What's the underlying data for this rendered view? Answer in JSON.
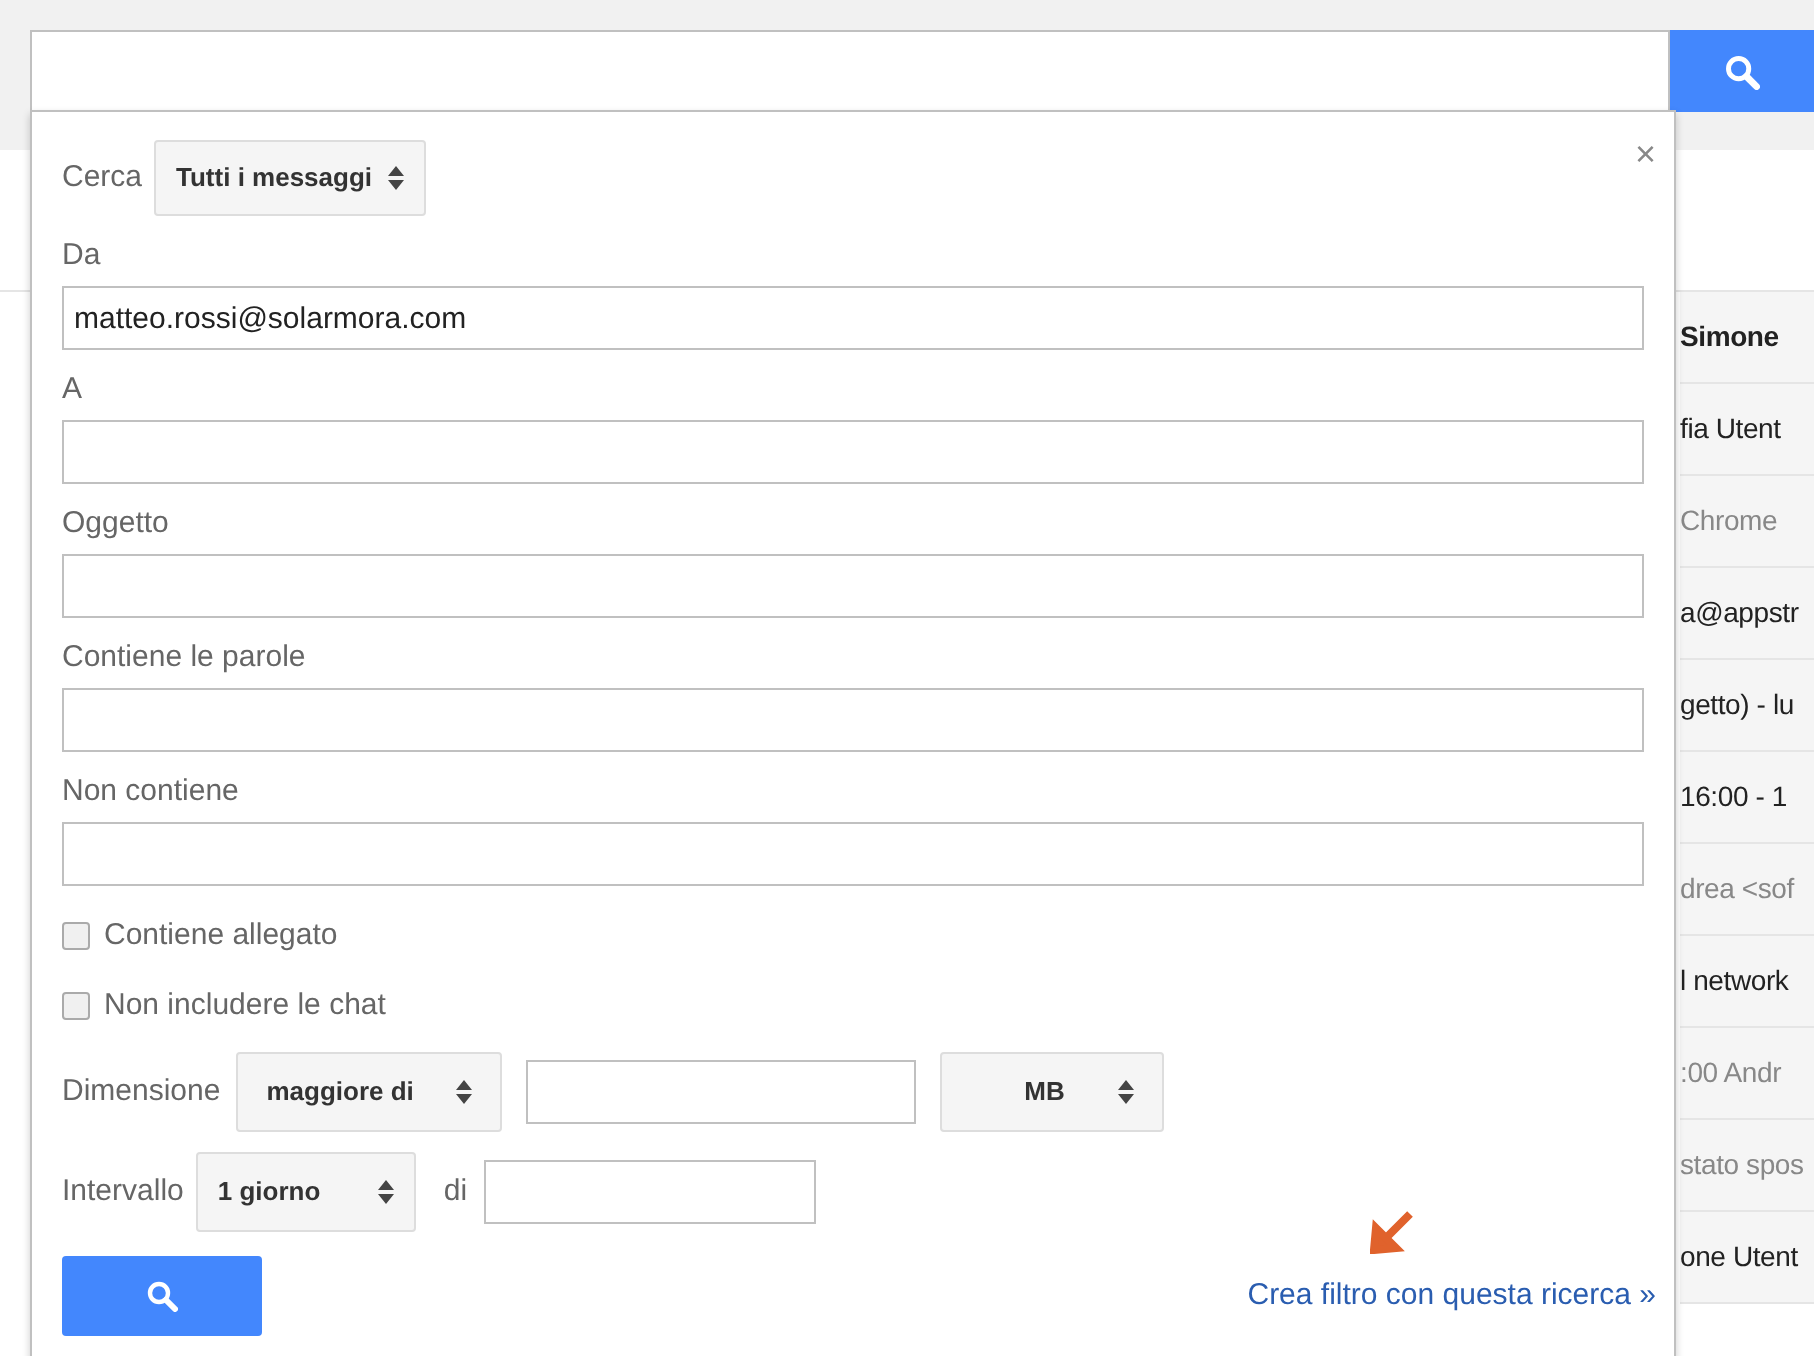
{
  "mail_list": [
    {
      "text": "Simone",
      "unread": true
    },
    {
      "text": "fia Utent",
      "unread": true
    },
    {
      "text": "Chrome",
      "unread": false
    },
    {
      "text": "a@appstr",
      "unread": true
    },
    {
      "text": "getto) - lu",
      "unread": true
    },
    {
      "text": "16:00 - 1",
      "unread": true
    },
    {
      "text": "drea <sof",
      "unread": false
    },
    {
      "text": "l network",
      "unread": true
    },
    {
      "text": ":00 Andr",
      "unread": false
    },
    {
      "text": "stato spos",
      "unread": false
    },
    {
      "text": "one Utent",
      "unread": true
    }
  ],
  "search_panel": {
    "scope_label": "Cerca",
    "scope_value": "Tutti i messaggi",
    "close": "×",
    "fields": [
      {
        "label": "Da",
        "value": "matteo.rossi@solarmora.com"
      },
      {
        "label": "A"
      },
      {
        "label": "Oggetto"
      },
      {
        "label": "Contiene le parole"
      },
      {
        "label": "Non contiene"
      }
    ],
    "checkboxes": [
      {
        "label": "Contiene allegato",
        "checked": false
      },
      {
        "label": "Non includere le chat",
        "checked": false
      }
    ],
    "size": {
      "label": "Dimensione",
      "operator": "maggiore di",
      "unit": "MB"
    },
    "range": {
      "label": "Intervallo",
      "value": "1 giorno",
      "of": "di"
    },
    "filter_link": "Crea filtro con questa ricerca »"
  }
}
